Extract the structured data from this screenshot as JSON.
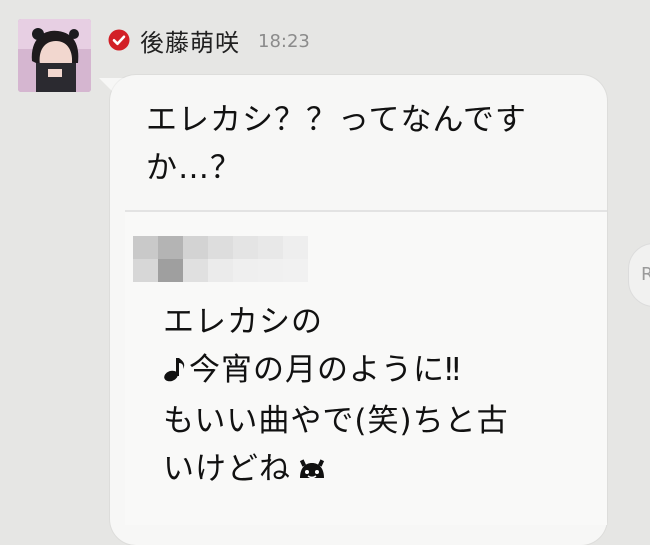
{
  "chat": {
    "sender_name": "後藤萌咲",
    "timestamp": "18:23",
    "verified_icon": "red-check-icon",
    "avatar_icon": "profile-photo-avatar"
  },
  "message": {
    "reply_lines": [
      "エレカシ？？ってなんです",
      "か…？"
    ],
    "quoted_lines": [
      "エレカシの",
      "今宵の月のように‼",
      "もいい曲やで(笑)ちと古",
      "いけどね"
    ],
    "quoted_line_icons": {
      "line_1_prefix": "music-note-icon",
      "line_3_suffix": "face-emoji-icon"
    }
  },
  "side_button": {
    "label": "R"
  },
  "colors": {
    "background": "#e6e6e4",
    "bubble": "#f7f7f6",
    "verified_red": "#d21f26",
    "timestamp": "#8b8b8b"
  }
}
